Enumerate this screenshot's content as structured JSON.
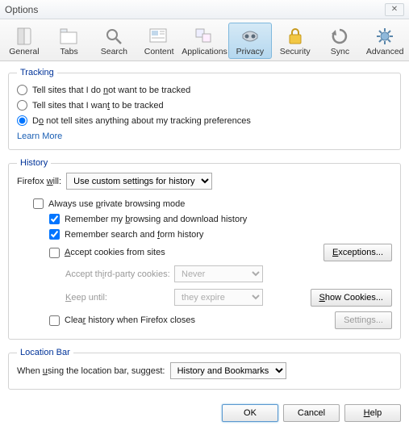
{
  "window": {
    "title": "Options"
  },
  "tabs": {
    "general": "General",
    "tabs": "Tabs",
    "search": "Search",
    "content": "Content",
    "applications": "Applications",
    "privacy": "Privacy",
    "security": "Security",
    "sync": "Sync",
    "advanced": "Advanced"
  },
  "tracking": {
    "legend": "Tracking",
    "opt1": "Tell sites that I do not want to be tracked",
    "opt2": "Tell sites that I want to be tracked",
    "opt3": "Do not tell sites anything about my tracking preferences",
    "learn": "Learn More"
  },
  "history": {
    "legend": "History",
    "will_label": "Firefox will:",
    "will_value": "Use custom settings for history",
    "always_private": "Always use private browsing mode",
    "remember_browsing": "Remember my browsing and download history",
    "remember_search": "Remember search and form history",
    "accept_cookies": "Accept cookies from sites",
    "exceptions": "Exceptions...",
    "accept_third_label": "Accept third-party cookies:",
    "accept_third_value": "Never",
    "keep_until_label": "Keep until:",
    "keep_until_value": "they expire",
    "show_cookies": "Show Cookies...",
    "clear_on_close": "Clear history when Firefox closes",
    "settings": "Settings..."
  },
  "location": {
    "legend": "Location Bar",
    "label": "When using the location bar, suggest:",
    "value": "History and Bookmarks"
  },
  "footer": {
    "ok": "OK",
    "cancel": "Cancel",
    "help": "Help"
  }
}
